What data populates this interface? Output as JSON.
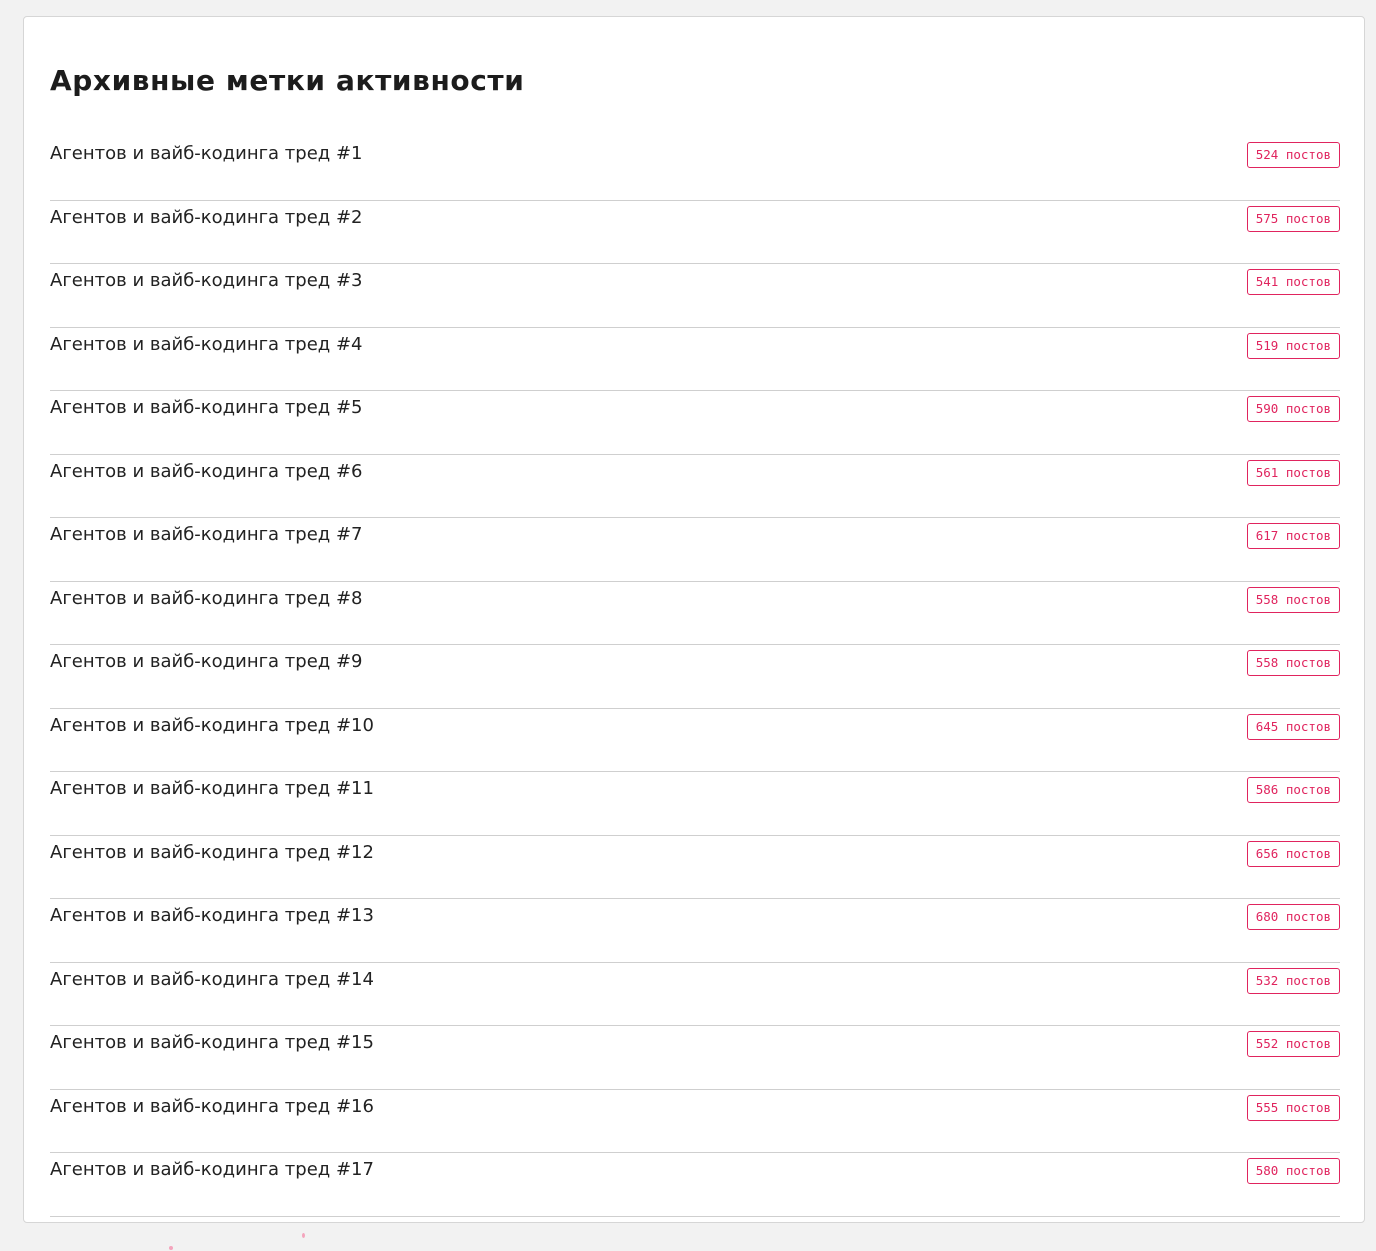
{
  "page": {
    "title": "Архивные метки активности"
  },
  "threads": [
    {
      "title": "Агентов и вайб-кодинга тред #1",
      "posts": "524 постов"
    },
    {
      "title": "Агентов и вайб-кодинга тред #2",
      "posts": "575 постов"
    },
    {
      "title": "Агентов и вайб-кодинга тред #3",
      "posts": "541 постов"
    },
    {
      "title": "Агентов и вайб-кодинга тред #4",
      "posts": "519 постов"
    },
    {
      "title": "Агентов и вайб-кодинга тред #5",
      "posts": "590 постов"
    },
    {
      "title": "Агентов и вайб-кодинга тред #6",
      "posts": "561 постов"
    },
    {
      "title": "Агентов и вайб-кодинга тред #7",
      "posts": "617 постов"
    },
    {
      "title": "Агентов и вайб-кодинга тред #8",
      "posts": "558 постов"
    },
    {
      "title": "Агентов и вайб-кодинга тред #9",
      "posts": "558 постов"
    },
    {
      "title": "Агентов и вайб-кодинга тред #10",
      "posts": "645 постов"
    },
    {
      "title": "Агентов и вайб-кодинга тред #11",
      "posts": "586 постов"
    },
    {
      "title": "Агентов и вайб-кодинга тред #12",
      "posts": "656 постов"
    },
    {
      "title": "Агентов и вайб-кодинга тред #13",
      "posts": "680 постов"
    },
    {
      "title": "Агентов и вайб-кодинга тред #14",
      "posts": "532 постов"
    },
    {
      "title": "Агентов и вайб-кодинга тред #15",
      "posts": "552 постов"
    },
    {
      "title": "Агентов и вайб-кодинга тред #16",
      "posts": "555 постов"
    },
    {
      "title": "Агентов и вайб-кодинга тред #17",
      "posts": "580 постов"
    }
  ],
  "colors": {
    "accent": "#e0245e",
    "background": "#f2f2f2",
    "card": "#ffffff",
    "divider": "#cfcfcf"
  }
}
